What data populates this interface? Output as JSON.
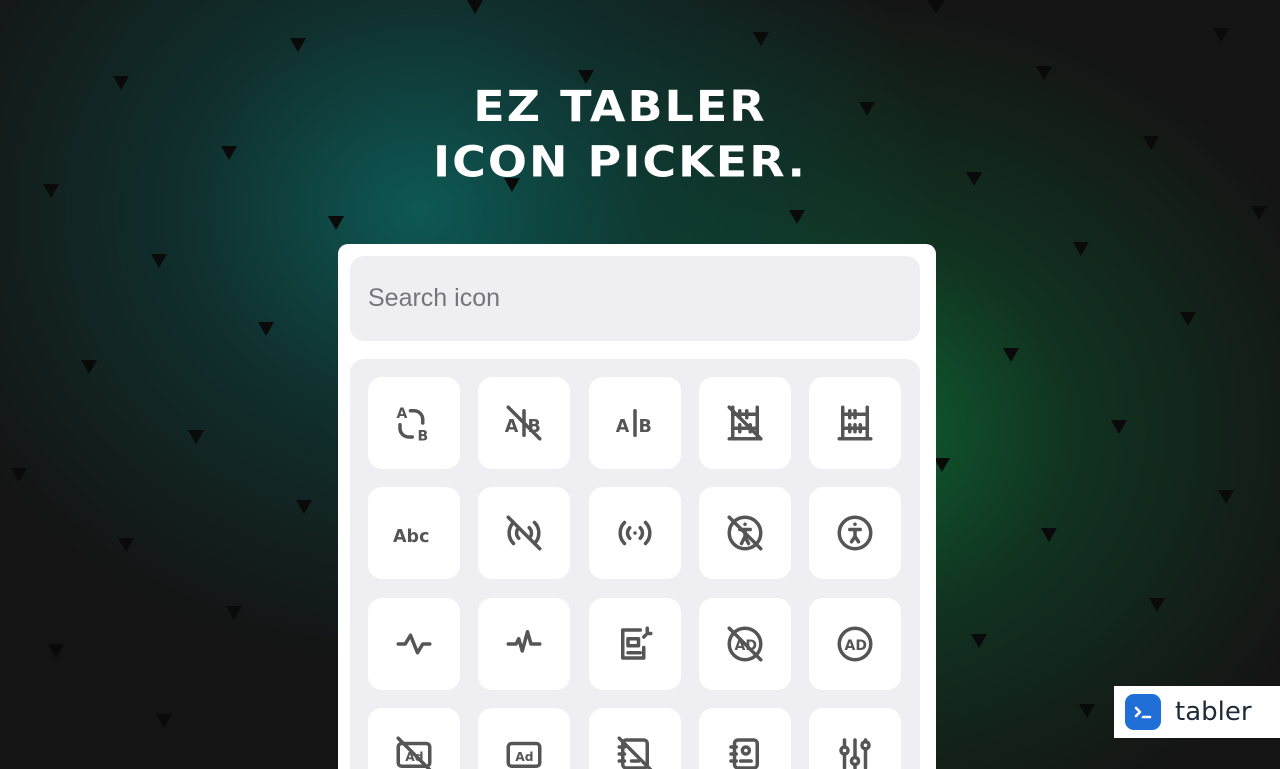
{
  "header": {
    "title_line1": "EZ TABLER",
    "title_line2": "ICON PICKER."
  },
  "search": {
    "placeholder": "Search icon",
    "value": ""
  },
  "icons": [
    "a-b-2",
    "a-b-off",
    "a-b",
    "abacus-off",
    "abacus",
    "abc",
    "access-point-off",
    "access-point",
    "accessible-off",
    "accessible",
    "activity",
    "activity-heartbeat",
    "ad-2",
    "ad-circle-off",
    "ad-circle",
    "ad-off",
    "ad",
    "address-book-off",
    "address-book",
    "adjustments-horizontal"
  ],
  "brand": {
    "name": "tabler"
  },
  "colors": {
    "accent": "#1f6fd6",
    "icon": "#555555",
    "panel": "#ffffff",
    "field": "#efeff3"
  }
}
